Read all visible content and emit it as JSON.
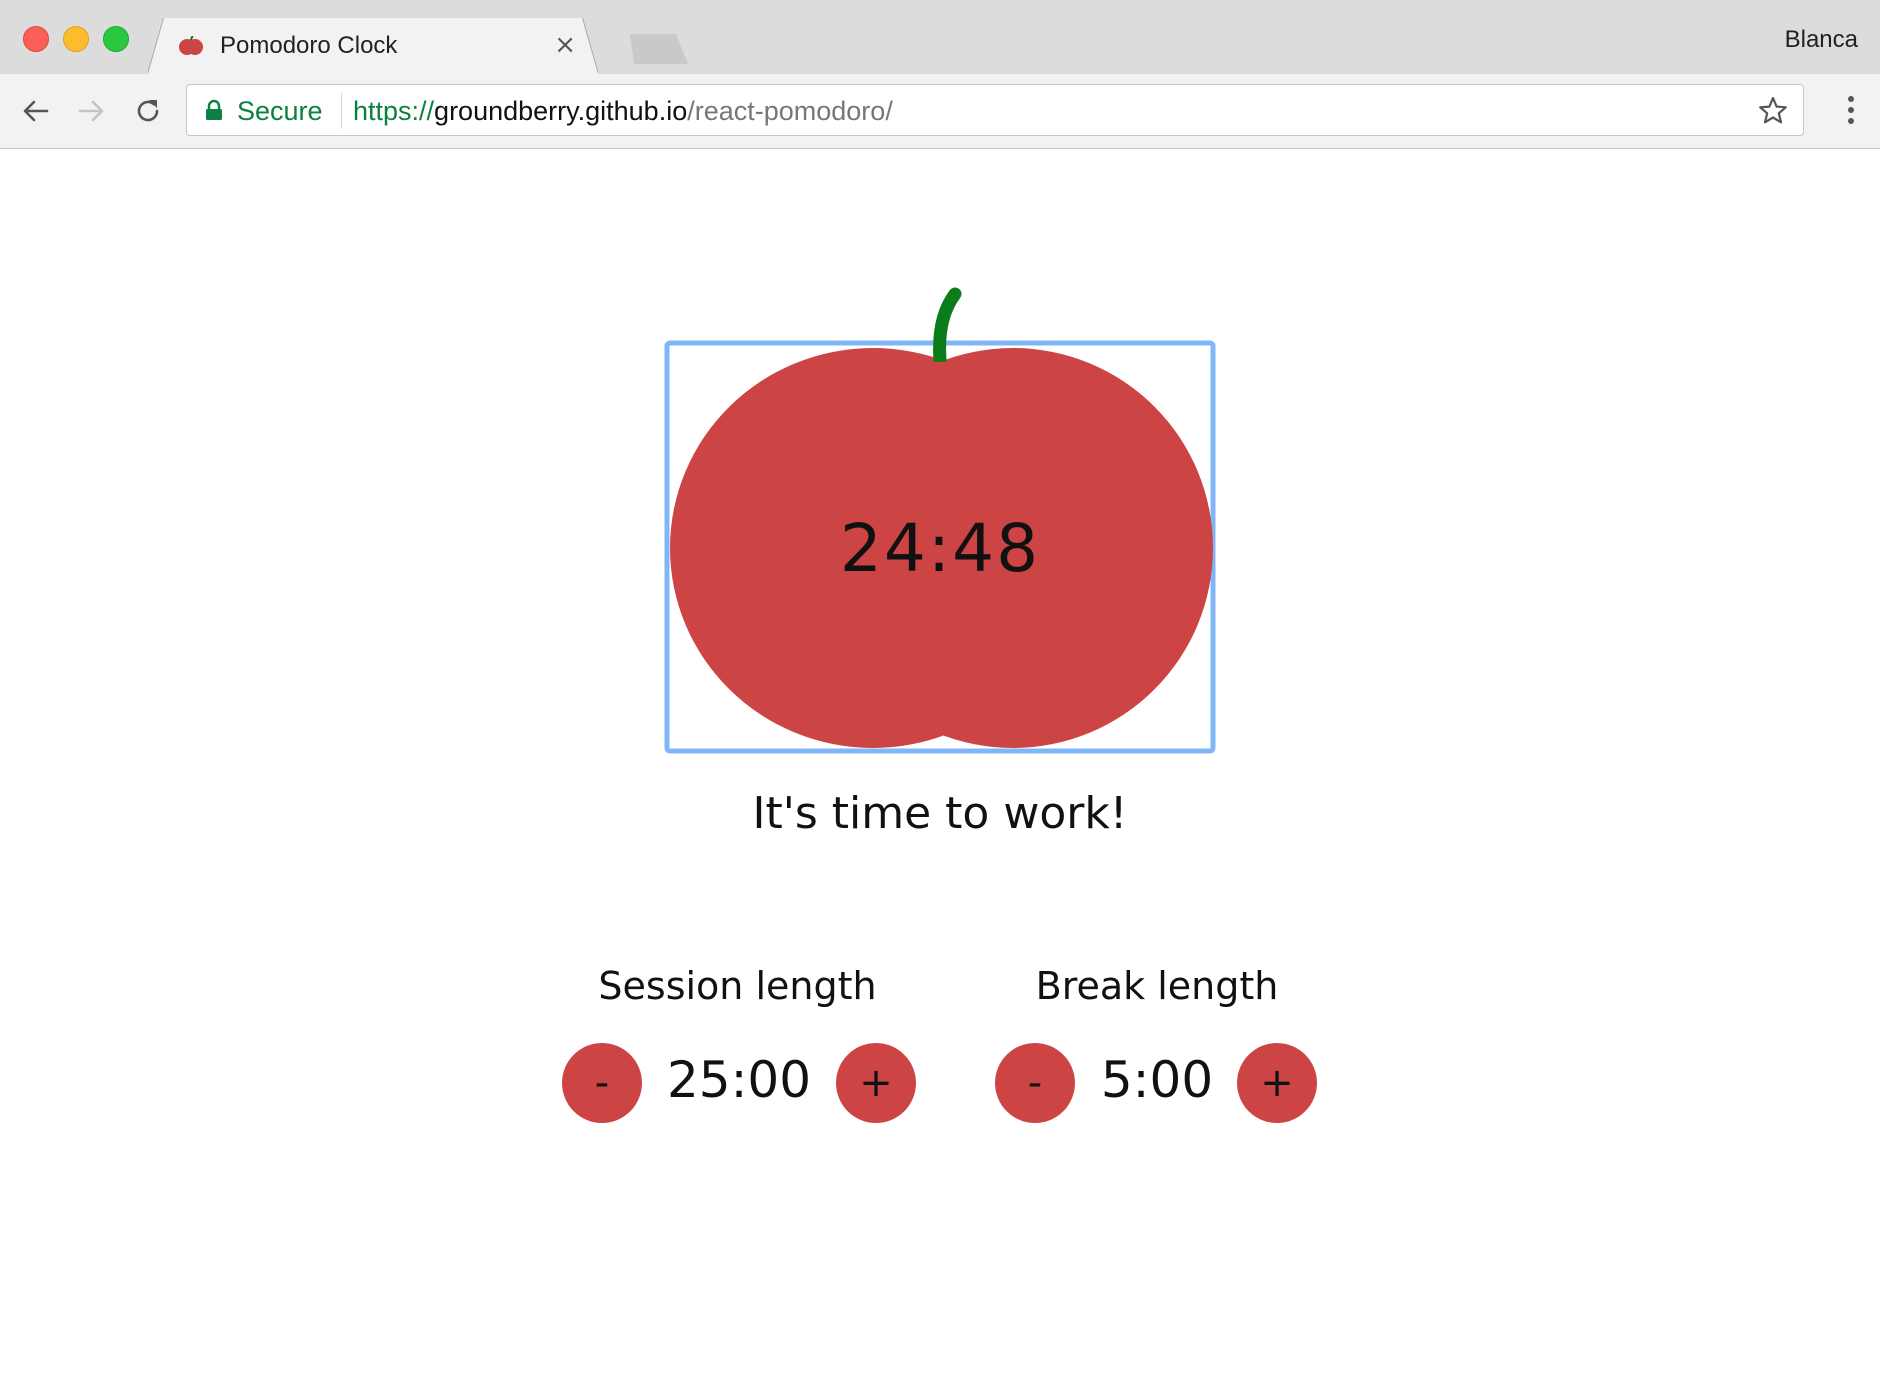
{
  "browser": {
    "tab_title": "Pomodoro Clock",
    "tab_close": "×",
    "profile_name": "Blanca",
    "secure_label": "Secure",
    "url_scheme": "https://",
    "url_host": "groundberry.github.io",
    "url_path": "/react-pomodoro/"
  },
  "clock": {
    "time_remaining": "24:48",
    "message": "It's time to work!"
  },
  "session": {
    "label": "Session length",
    "value": "25:00",
    "decrement_label": "-",
    "increment_label": "+"
  },
  "break": {
    "label": "Break length",
    "value": "5:00",
    "decrement_label": "-",
    "increment_label": "+"
  },
  "colors": {
    "tomato": "#cc4444",
    "stem": "#0a7d1a",
    "focus_outline": "#7fb6f7",
    "secure_green": "#0b8043"
  },
  "icons": {
    "favicon": "tomato-icon",
    "back": "arrow-left-icon",
    "forward": "arrow-right-icon",
    "reload": "reload-icon",
    "lock": "lock-icon",
    "bookmark": "star-icon",
    "menu": "more-vert-icon"
  }
}
